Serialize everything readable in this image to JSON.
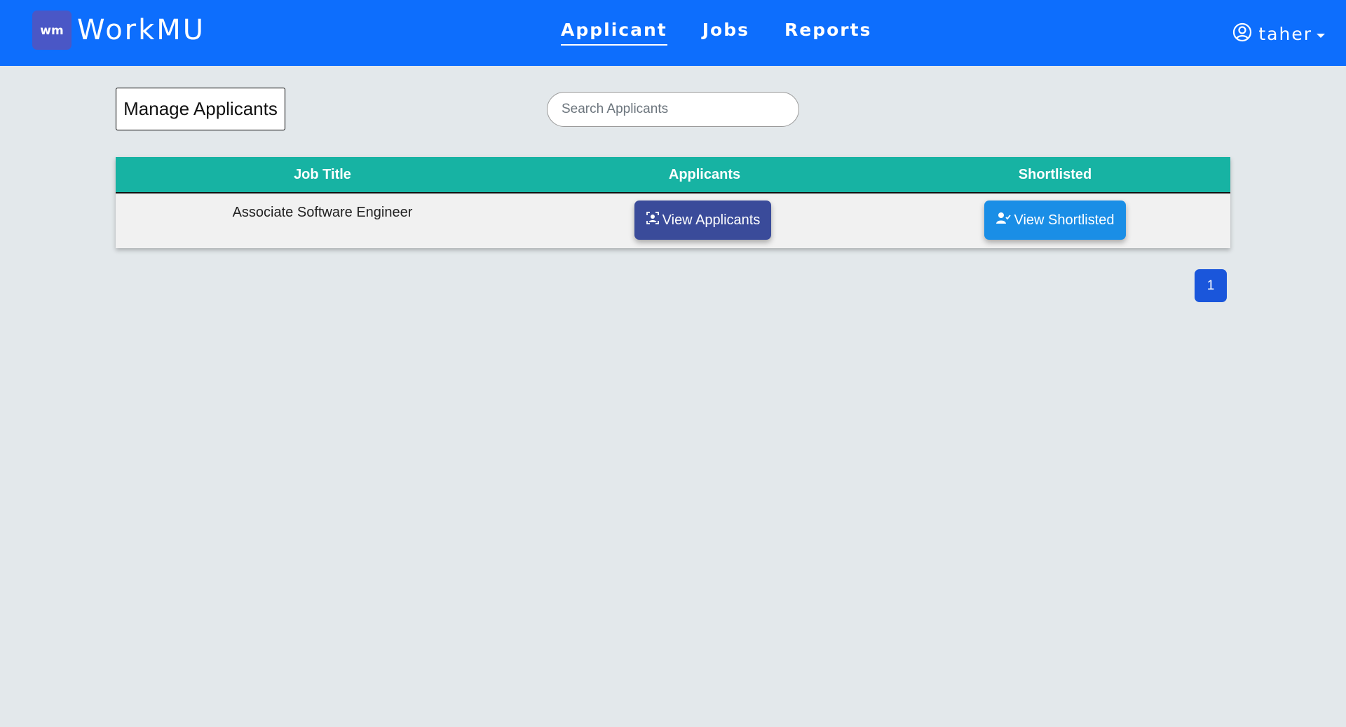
{
  "brand": {
    "logo_text": "wm",
    "name": "WorkMU"
  },
  "nav": {
    "items": [
      {
        "label": "Applicant"
      },
      {
        "label": "Jobs"
      },
      {
        "label": "Reports"
      }
    ],
    "active": "Applicant"
  },
  "user": {
    "name": "taher"
  },
  "page": {
    "heading": "Manage Applicants"
  },
  "search": {
    "placeholder": "Search Applicants",
    "value": ""
  },
  "table": {
    "headers": [
      "Job Title",
      "Applicants",
      "Shortlisted"
    ],
    "rows": [
      {
        "job_title": "Associate Software Engineer",
        "applicants_button": "View Applicants",
        "shortlisted_button": "View Shortlisted"
      }
    ]
  },
  "pagination": {
    "current_page": "1"
  },
  "colors": {
    "navbar": "#0d6efd",
    "table_header": "#17b3a3",
    "view_applicants_button": "#3a4b9a",
    "view_shortlisted_button": "#1a8ee6",
    "pagination_active": "#1a56db",
    "page_background": "#e3e8eb"
  },
  "icons": {
    "brand": "workmu-logo-icon",
    "user": "user-circle-icon",
    "caret": "caret-down-icon",
    "view_applicants": "user-frame-icon",
    "view_shortlisted": "user-check-icon"
  }
}
